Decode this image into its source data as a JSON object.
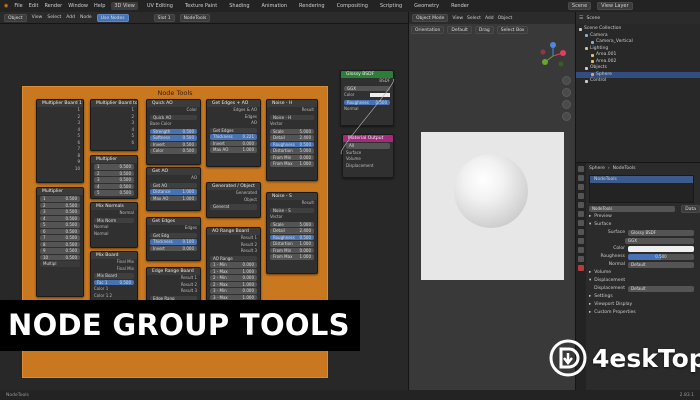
{
  "menubar": {
    "menus": [
      "File",
      "Edit",
      "Render",
      "Window",
      "Help"
    ],
    "workspaces": [
      "3D View",
      "UV Editing",
      "Texture Paint",
      "Shading",
      "Animation",
      "Rendering",
      "Compositing",
      "Scripting",
      "Geometry",
      "Render"
    ],
    "active_workspace": "3D View",
    "scene": "Scene",
    "view_layer": "View Layer"
  },
  "node_editor": {
    "header": {
      "editor_type": "Object",
      "menus": [
        "View",
        "Select",
        "Add",
        "Node"
      ],
      "use_nodes_label": "Use Nodes",
      "slot": "Slot 1",
      "material": "NodeTools"
    },
    "frame_title": "Node Tools",
    "nodes": {
      "multiplier_board_1": {
        "title": "Multiplier Board 1",
        "rows": [
          "1",
          "2",
          "3",
          "4",
          "5",
          "6",
          "7",
          "8",
          "9",
          "10"
        ],
        "footer": "Multipl"
      },
      "multiplier_board_2": {
        "title": "Multiplier Board to",
        "rows": [
          "1",
          "2",
          "3",
          "4",
          "5",
          "6"
        ]
      },
      "quick_ao": {
        "title": "Quick AO",
        "rows": [
          "Color"
        ],
        "sub": "Quick AO",
        "fields": [
          [
            "Base Color",
            ""
          ],
          [
            "Strength",
            "0.500"
          ],
          [
            "Softness",
            "0.500"
          ],
          [
            "Invert",
            "0.500"
          ],
          [
            "Color",
            "0.500"
          ]
        ]
      },
      "get_edges_ao": {
        "title": "Get Edges + AO",
        "rows": [
          "Edges & AO",
          "Edges",
          "AO"
        ],
        "sub": "Get Edges",
        "fields": [
          [
            "Thickness",
            "0.221"
          ],
          [
            "Invert",
            "0.000"
          ],
          [
            "Max AO",
            "1.000"
          ]
        ]
      },
      "noise_h": {
        "title": "Noise - H",
        "rows": [
          "Result"
        ],
        "sub": "Noise - H",
        "fields": [
          [
            "Scale",
            "5.000"
          ],
          [
            "Detail",
            "2.400"
          ],
          [
            "Roughness",
            "0.500"
          ],
          [
            "Distortion",
            "5.000"
          ],
          [
            "From Min",
            "0.000"
          ],
          [
            "From Max",
            "1.000"
          ]
        ],
        "vector_label": "Vector"
      },
      "multiplier_table": {
        "title": "Multiplier",
        "values": [
          "0.500",
          "0.500",
          "0.500",
          "0.500",
          "0.500"
        ]
      },
      "multiplier_left": {
        "title": "Multiplier",
        "values": [
          "0.500",
          "0.500",
          "0.500",
          "0.500",
          "0.500",
          "0.500",
          "0.500",
          "0.500",
          "0.500",
          "0.500"
        ],
        "index": [
          "1",
          "2",
          "3",
          "4",
          "5",
          "6",
          "7",
          "8",
          "9",
          "10"
        ]
      },
      "mix_normals": {
        "title": "Mix Normals",
        "rows": [
          "Normal"
        ],
        "sub": "Mix Norm",
        "fields": [
          [
            "Normal",
            ""
          ],
          [
            "Normal",
            ""
          ]
        ]
      },
      "mix_board": {
        "title": "Mix Board",
        "rows": [
          "Final Mix",
          "Final Mix"
        ],
        "sub": "Mix Board",
        "fields": [
          [
            "Fac 1",
            "0.500"
          ],
          [
            "Color 1",
            ""
          ],
          [
            "Color 1.2",
            ""
          ],
          [
            "Fac 2",
            "0.500"
          ]
        ]
      },
      "get_ao": {
        "title": "Get AO",
        "rows": [
          "AO"
        ],
        "sub": "Get AO",
        "fields": [
          [
            "Distance",
            "1.000"
          ],
          [
            "Max AO",
            "1.000"
          ]
        ]
      },
      "get_edges": {
        "title": "Get Edges",
        "rows": [
          "Edges"
        ],
        "sub": "Get Edg",
        "fields": [
          [
            "Thickness",
            "0.100"
          ],
          [
            "Invert",
            "0.000"
          ]
        ]
      },
      "generated_object": {
        "title": "Generated / Object",
        "rows": [
          "Generated",
          "Object"
        ],
        "sub": "Generat"
      },
      "noise_s": {
        "title": "Noise - S",
        "rows": [
          "Result"
        ],
        "sub": "Noise - S",
        "fields": [
          [
            "Scale",
            "5.000"
          ],
          [
            "Detail",
            "2.400"
          ],
          [
            "Roughness",
            "0.500"
          ],
          [
            "Distortion",
            "1.000"
          ],
          [
            "From Min",
            "0.000"
          ],
          [
            "From Max",
            "1.000"
          ]
        ],
        "vector_label": "Vector"
      },
      "ao_range_board": {
        "title": "AO Range Board",
        "rows": [
          "Result 1",
          "Result 2",
          "Result 3"
        ],
        "sub": "AO Range",
        "fields": [
          [
            "1 - Min",
            "0.000"
          ],
          [
            "1 - Max",
            "1.000"
          ],
          [
            "2 - Min",
            "0.000"
          ],
          [
            "2 - Max",
            "1.000"
          ],
          [
            "3 - Min",
            "0.000"
          ],
          [
            "3 - Max",
            "1.000"
          ]
        ]
      },
      "edge_range_board": {
        "title": "Edge Range Board",
        "rows": [
          "Result 1",
          "Result 2",
          "Result 3"
        ],
        "sub": "Edge Rang",
        "fields": [
          [
            "Radius",
            "1.000"
          ]
        ]
      },
      "glossy_bsdf": {
        "title": "Glossy BSDF",
        "rows": [
          "BSDF"
        ],
        "fields": [
          [
            "GGX",
            ""
          ],
          [
            "Color",
            ""
          ],
          [
            "Roughness",
            "0.500"
          ]
        ],
        "normal_label": "Normal"
      },
      "material_output": {
        "title": "Material Output",
        "rows": [
          "All",
          "Surface",
          "Volume",
          "Displacement"
        ]
      }
    }
  },
  "viewport": {
    "header": [
      "Object Mode",
      "View",
      "Select",
      "Add",
      "Object"
    ],
    "orientation": "Orientation",
    "pivot": "Default",
    "drag": "Drag",
    "select_box": "Select Box"
  },
  "outliner": {
    "title": "Scene Collection",
    "items": [
      {
        "label": "Scene Collection",
        "color": "#cccccc",
        "indent": 0,
        "selected": false
      },
      {
        "label": "Camera",
        "color": "#7fb0d9",
        "indent": 1,
        "selected": false
      },
      {
        "label": "Camera_Vertical",
        "color": "#7fb0d9",
        "indent": 2,
        "selected": false
      },
      {
        "label": "Lighting",
        "color": "#d9c27f",
        "indent": 1,
        "selected": false
      },
      {
        "label": "Area.001",
        "color": "#d9c27f",
        "indent": 2,
        "selected": false
      },
      {
        "label": "Area.002",
        "color": "#d9c27f",
        "indent": 2,
        "selected": false
      },
      {
        "label": "Objects",
        "color": "#cccccc",
        "indent": 1,
        "selected": false
      },
      {
        "label": "Sphere",
        "color": "#e6a44c",
        "indent": 2,
        "selected": true
      },
      {
        "label": "Control",
        "color": "#cccccc",
        "indent": 1,
        "selected": false
      }
    ]
  },
  "properties": {
    "object": "Sphere",
    "material": "NodeTools",
    "slot_label": "NodeTools",
    "data_label": "Data",
    "sections": [
      "Preview",
      "Surface"
    ],
    "surface": "Glossy BSDF",
    "distribution": "GGX",
    "color_label": "Color",
    "roughness_label": "Roughness",
    "roughness_value": "0.500",
    "normal_label": "Normal",
    "normal_value": "Default",
    "volume": "Volume",
    "displacement": "Displacement",
    "displacement_value": "Default",
    "settings": "Settings",
    "viewport_display": "Viewport Display",
    "custom_props": "Custom Properties"
  },
  "statusbar": {
    "left": "NodeTools",
    "right": "2.83.1"
  },
  "caption": "NODE GROUP TOOLS",
  "watermark": "4eskTop",
  "colors": {
    "frame": "#c9781f",
    "accent_blue": "#4772b3",
    "node_green": "#2f7d3a",
    "node_pink": "#a12c7b"
  }
}
